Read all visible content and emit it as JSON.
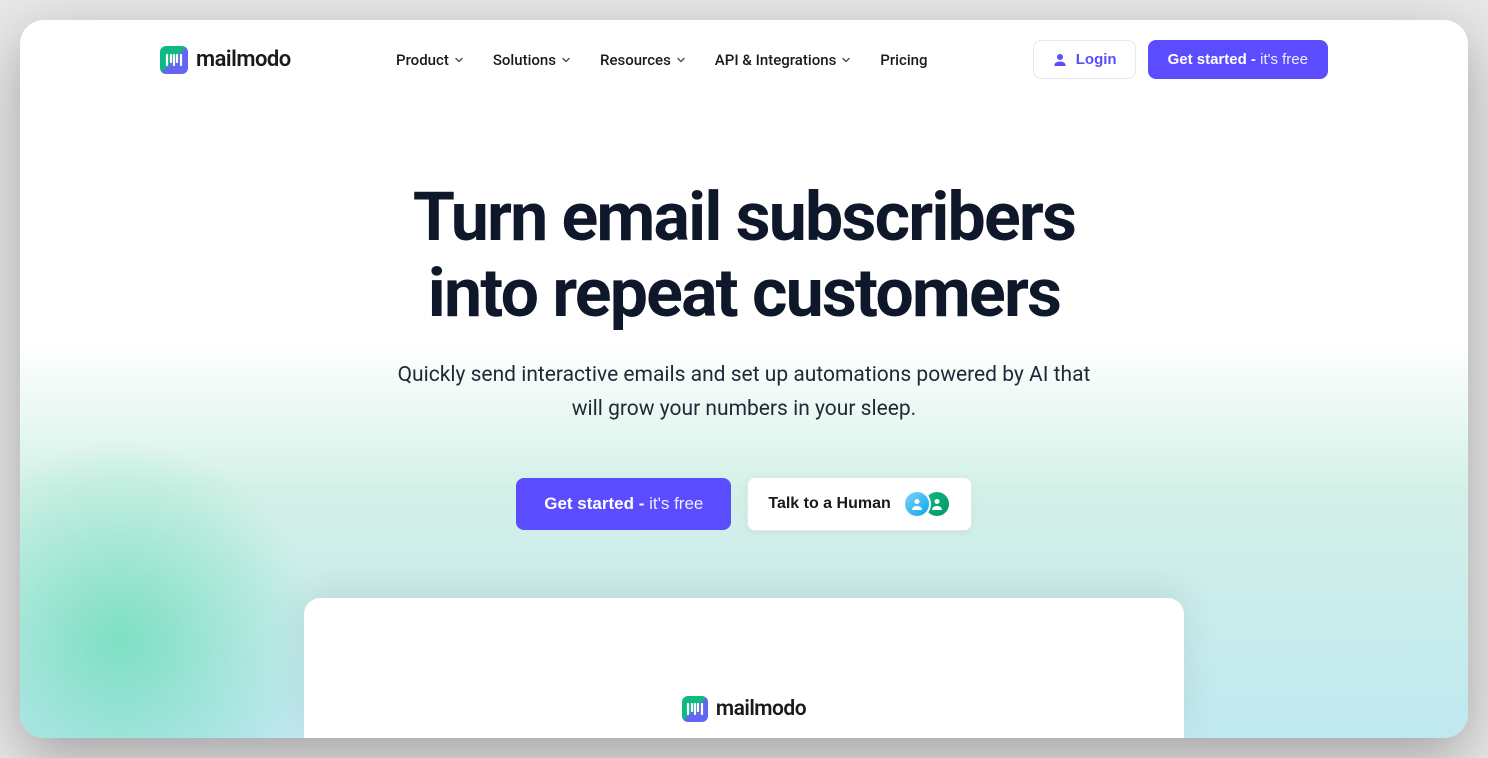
{
  "brand": {
    "name": "mailmodo"
  },
  "nav": {
    "items": [
      {
        "label": "Product",
        "has_dropdown": true
      },
      {
        "label": "Solutions",
        "has_dropdown": true
      },
      {
        "label": "Resources",
        "has_dropdown": true
      },
      {
        "label": "API & Integrations",
        "has_dropdown": true
      },
      {
        "label": "Pricing",
        "has_dropdown": false
      }
    ]
  },
  "header": {
    "login_label": "Login",
    "cta_prefix": "Get started - ",
    "cta_suffix": "it's free"
  },
  "hero": {
    "title_line1": "Turn email subscribers",
    "title_line2": "into repeat customers",
    "subtitle": "Quickly send interactive emails and set up automations powered by AI that will grow your numbers in your sleep.",
    "cta_prefix": "Get started - ",
    "cta_suffix": "it's free",
    "talk_label": "Talk to a Human"
  },
  "preview": {
    "brand": "mailmodo"
  }
}
